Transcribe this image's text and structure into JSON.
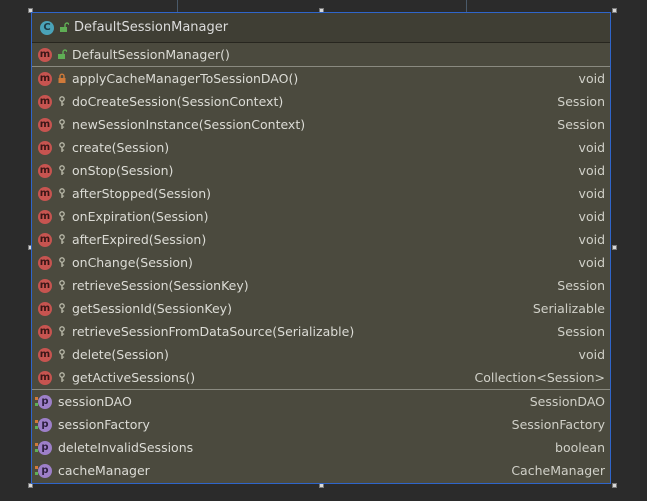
{
  "colors": {
    "card_background": "#4b4a3e",
    "selection_border": "#2f65ca",
    "class_icon": "#4aa3b8",
    "method_icon": "#c75450",
    "property_icon": "#9d7fc8",
    "public_green": "#5fae55",
    "private_orange": "#d07a3a"
  },
  "class_header": {
    "icon": "class-icon",
    "visibility": "public",
    "title": "DefaultSessionManager"
  },
  "constructors": [
    {
      "icon": "method-icon",
      "visibility": "public",
      "signature": "DefaultSessionManager()",
      "type": ""
    }
  ],
  "methods": [
    {
      "icon": "method-icon",
      "visibility": "private",
      "signature": "applyCacheManagerToSessionDAO()",
      "type": "void"
    },
    {
      "icon": "method-icon",
      "visibility": "protected",
      "signature": "doCreateSession(SessionContext)",
      "type": "Session"
    },
    {
      "icon": "method-icon",
      "visibility": "protected",
      "signature": "newSessionInstance(SessionContext)",
      "type": "Session"
    },
    {
      "icon": "method-icon",
      "visibility": "protected",
      "signature": "create(Session)",
      "type": "void"
    },
    {
      "icon": "method-icon",
      "visibility": "protected",
      "signature": "onStop(Session)",
      "type": "void"
    },
    {
      "icon": "method-icon",
      "visibility": "protected",
      "signature": "afterStopped(Session)",
      "type": "void"
    },
    {
      "icon": "method-icon",
      "visibility": "protected",
      "signature": "onExpiration(Session)",
      "type": "void"
    },
    {
      "icon": "method-icon",
      "visibility": "protected",
      "signature": "afterExpired(Session)",
      "type": "void"
    },
    {
      "icon": "method-icon",
      "visibility": "protected",
      "signature": "onChange(Session)",
      "type": "void"
    },
    {
      "icon": "method-icon",
      "visibility": "protected",
      "signature": "retrieveSession(SessionKey)",
      "type": "Session"
    },
    {
      "icon": "method-icon",
      "visibility": "protected",
      "signature": "getSessionId(SessionKey)",
      "type": "Serializable"
    },
    {
      "icon": "method-icon",
      "visibility": "protected",
      "signature": "retrieveSessionFromDataSource(Serializable)",
      "type": "Session"
    },
    {
      "icon": "method-icon",
      "visibility": "protected",
      "signature": "delete(Session)",
      "type": "void"
    },
    {
      "icon": "method-icon",
      "visibility": "protected",
      "signature": "getActiveSessions()",
      "type": "Collection<Session>"
    }
  ],
  "properties": [
    {
      "icon": "property-icon",
      "signature": "sessionDAO",
      "type": "SessionDAO"
    },
    {
      "icon": "property-icon",
      "signature": "sessionFactory",
      "type": "SessionFactory"
    },
    {
      "icon": "property-icon",
      "signature": "deleteInvalidSessions",
      "type": "boolean"
    },
    {
      "icon": "property-icon",
      "signature": "cacheManager",
      "type": "CacheManager"
    }
  ]
}
